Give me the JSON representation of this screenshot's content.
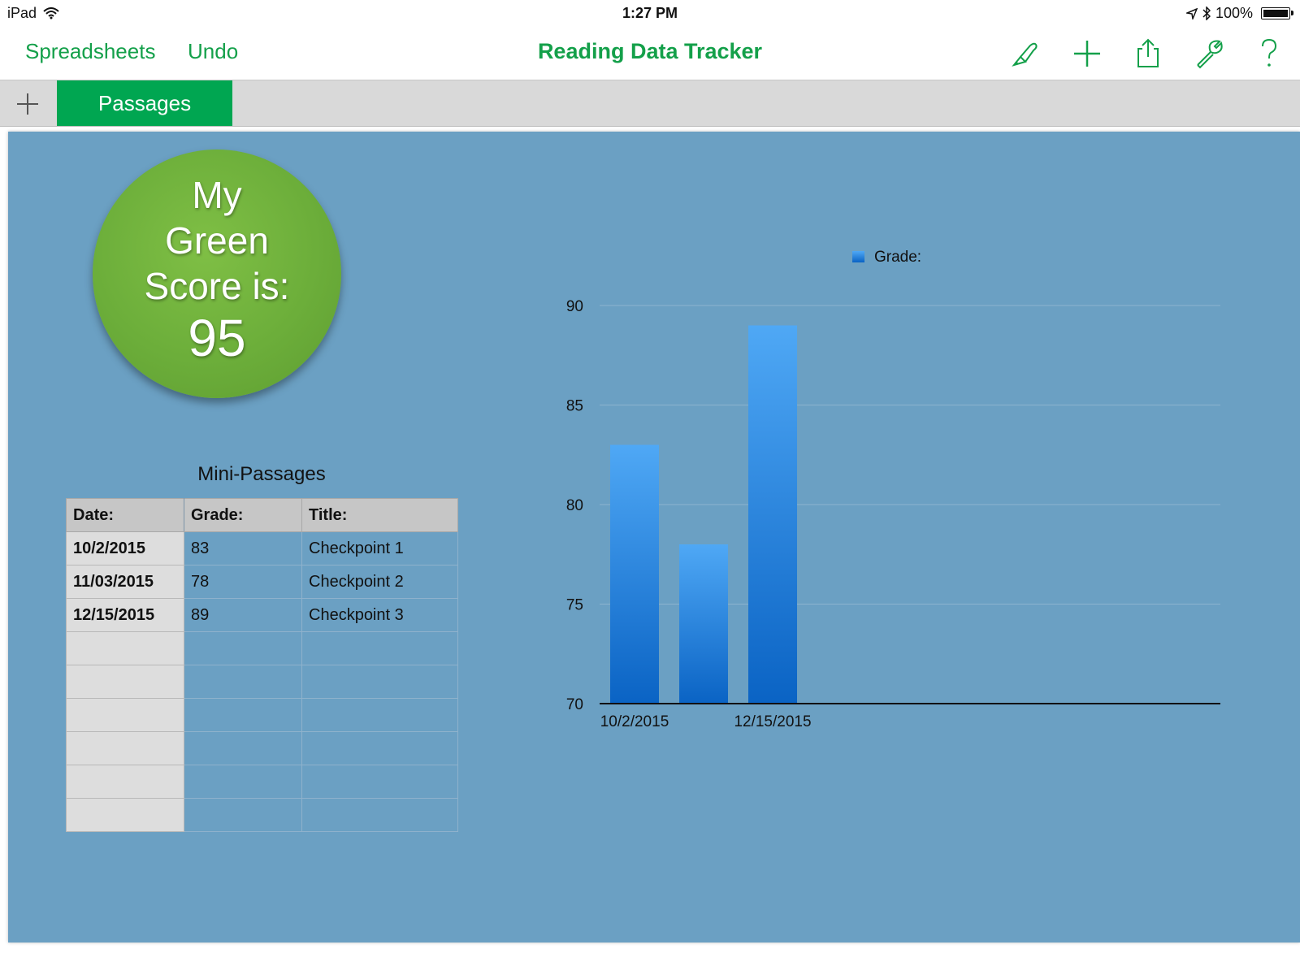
{
  "status_bar": {
    "device": "iPad",
    "time": "1:27 PM",
    "battery": "100%"
  },
  "toolbar": {
    "spreadsheets_label": "Spreadsheets",
    "undo_label": "Undo",
    "title": "Reading Data Tracker",
    "icons": [
      "paintbrush-icon",
      "plus-icon",
      "share-icon",
      "wrench-icon",
      "help-icon"
    ]
  },
  "tabs": {
    "items": [
      {
        "label": "Passages",
        "active": true
      }
    ]
  },
  "score_badge": {
    "label_line1": "My",
    "label_line2": "Green",
    "label_line3": "Score is:",
    "value": "95"
  },
  "table": {
    "title": "Mini-Passages",
    "headers": [
      "Date:",
      "Grade:",
      "Title:"
    ],
    "rows": [
      [
        "10/2/2015",
        "83",
        "Checkpoint 1"
      ],
      [
        "11/03/2015",
        "78",
        "Checkpoint 2"
      ],
      [
        "12/15/2015",
        "89",
        "Checkpoint 3"
      ],
      [
        "",
        "",
        ""
      ],
      [
        "",
        "",
        ""
      ],
      [
        "",
        "",
        ""
      ],
      [
        "",
        "",
        ""
      ],
      [
        "",
        "",
        ""
      ],
      [
        "",
        "",
        ""
      ]
    ]
  },
  "colors": {
    "accent": "#14a04a",
    "tab_active": "#00a651",
    "canvas": "#6ba0c3",
    "bar_top": "#4fa8f5",
    "bar_bottom": "#0a63c4"
  },
  "chart_data": {
    "type": "bar",
    "categories": [
      "10/2/2015",
      "11/03/2015",
      "12/15/2015"
    ],
    "visible_tick_labels": [
      "10/2/2015",
      "",
      "12/15/2015"
    ],
    "series": [
      {
        "name": "Grade:",
        "values": [
          83,
          78,
          89
        ]
      }
    ],
    "ylim": [
      70,
      90
    ],
    "yticks": [
      70,
      75,
      80,
      85,
      90
    ],
    "grid": true,
    "legend": "top-center"
  }
}
